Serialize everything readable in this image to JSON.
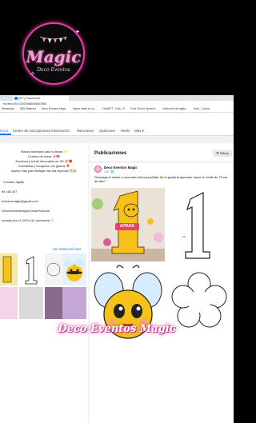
{
  "logo": {
    "title": "Magic",
    "subtitle": "Deco Eventos"
  },
  "browser": {
    "tab_title": "(20+) Facebook",
    "address": "m/deco?id=100006660080550",
    "bookmarks": [
      "WhatsApp",
      "(99) Pinterest",
      "Deco Eventos Magi...",
      "Hacer vestir en tu...",
      "ChatGPT - DALL-E",
      "Free Text to Speech...",
      "Instructor de inglés...",
      "Hola - Canva"
    ]
  },
  "fb_nav": {
    "items": [
      "Inicio",
      "Centro de suscripciones",
      "Información",
      "Menciones",
      "Opiniones",
      "Reels",
      "Más ▾"
    ]
  },
  "intro": {
    "lines": [
      "Videos tutoriales para tu fiesta ✨",
      "Centros de mesa 🌸🎀",
      "Numeros y letras decorados en 3D 🎉🎁",
      "Guirnaldas y bouquets con globos 🎈",
      "mucho mas para festejar ese dia especial 🎊🎉"
    ],
    "category": "· Creador digital",
    "phone": "98 166 307",
    "email": "eventosmagic@gmail.com",
    "youtube": "DecoEventosMagic/Canal/Youtube",
    "recommend": "endado por el 100% (10 opiniones) ⓘ",
    "photos_link": "Ver todas las fotos"
  },
  "posts": {
    "title": "Publicaciones",
    "filter_label": "⇅ Filtros",
    "author": "Deco Eventos Magic",
    "date": "1 d · 🌐",
    "text": "Descarga el molde y crea esta hermosa piñata 🐝 te gustaría aprender hacer el molde de 70 cm. de alto?",
    "topper_name": "AITANA"
  },
  "banner": "Deco Eventos Magic",
  "colors": {
    "fb_blue": "#1877f2",
    "brand_pink": "#e94fa7",
    "bee_yellow": "#f6c21a"
  }
}
